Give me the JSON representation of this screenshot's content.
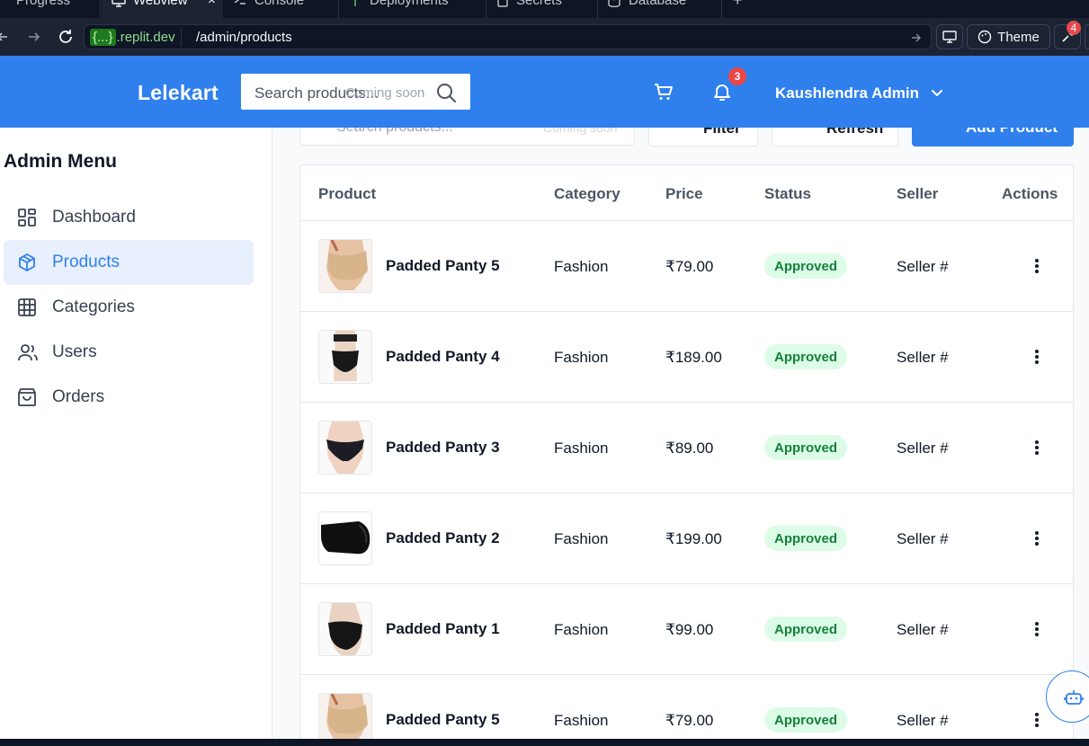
{
  "chrome": {
    "tabs": [
      {
        "label": "Progress",
        "icon": "progress-icon"
      },
      {
        "label": "Webview",
        "icon": "monitor-icon",
        "active": true
      },
      {
        "label": "Console",
        "icon": "terminal-icon"
      },
      {
        "label": "Deployments",
        "icon": "deploy-icon"
      },
      {
        "label": "Secrets",
        "icon": "lock-icon"
      },
      {
        "label": "Database",
        "icon": "database-icon"
      }
    ],
    "close_label": "×",
    "new_tab_label": "+",
    "url": {
      "brace": "{...}",
      "domain": ".replit.dev",
      "path": "/admin/products"
    },
    "theme_label": "Theme",
    "notification_count": "4"
  },
  "header": {
    "logo": "Lelekart",
    "search_placeholder": "Search products...",
    "search_coming_soon": "Coming soon",
    "notification_badge": "3",
    "user_name": "Kaushlendra Admin",
    "brand_color": "#2f80ed"
  },
  "sidebar": {
    "title": "Admin Menu",
    "items": [
      {
        "label": "Dashboard",
        "icon": "dashboard-icon"
      },
      {
        "label": "Products",
        "icon": "package-icon",
        "active": true
      },
      {
        "label": "Categories",
        "icon": "grid-icon"
      },
      {
        "label": "Users",
        "icon": "users-icon"
      },
      {
        "label": "Orders",
        "icon": "shopping-bag-icon"
      }
    ]
  },
  "toolbar": {
    "search_placeholder": "Search products...",
    "search_coming_soon": "Coming soon",
    "filter_label": "Filter",
    "refresh_label": "Refresh",
    "add_label": "Add Product"
  },
  "table": {
    "columns": [
      "Product",
      "Category",
      "Price",
      "Status",
      "Seller",
      "Actions"
    ],
    "rows": [
      {
        "name": "Padded Panty 5",
        "category": "Fashion",
        "price": "₹79.00",
        "status": "Approved",
        "seller": "Seller #",
        "image": "nude"
      },
      {
        "name": "Padded Panty 4",
        "category": "Fashion",
        "price": "₹189.00",
        "status": "Approved",
        "seller": "Seller #",
        "image": "black-model"
      },
      {
        "name": "Padded Panty 3",
        "category": "Fashion",
        "price": "₹89.00",
        "status": "Approved",
        "seller": "Seller #",
        "image": "black-brief"
      },
      {
        "name": "Padded Panty 2",
        "category": "Fashion",
        "price": "₹199.00",
        "status": "Approved",
        "seller": "Seller #",
        "image": "black-side"
      },
      {
        "name": "Padded Panty 1",
        "category": "Fashion",
        "price": "₹99.00",
        "status": "Approved",
        "seller": "Seller #",
        "image": "black-back"
      },
      {
        "name": "Padded Panty 5",
        "category": "Fashion",
        "price": "₹79.00",
        "status": "Approved",
        "seller": "Seller #",
        "image": "nude"
      }
    ]
  }
}
